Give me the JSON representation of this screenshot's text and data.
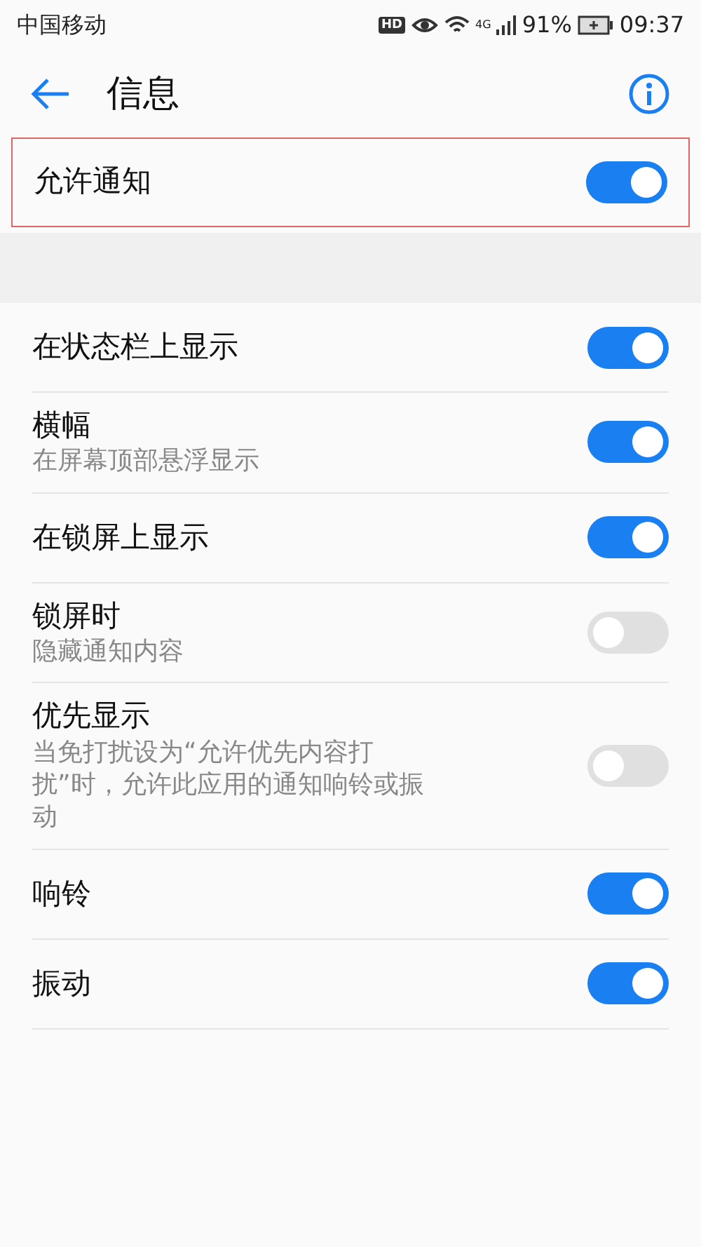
{
  "status_bar": {
    "carrier": "中国移动",
    "hd_badge": "HD",
    "network": "4G",
    "battery": "91%",
    "time": "09:37"
  },
  "header": {
    "title": "信息"
  },
  "main_toggle": {
    "label": "允许通知",
    "on": true,
    "highlighted": true
  },
  "settings": [
    {
      "label": "在状态栏上显示",
      "on": true
    },
    {
      "label": "横幅",
      "description": "在屏幕顶部悬浮显示",
      "on": true
    },
    {
      "label": "在锁屏上显示",
      "on": true
    },
    {
      "label": "锁屏时",
      "description": "隐藏通知内容",
      "on": false
    },
    {
      "label": "优先显示",
      "description": "当免打扰设为“允许优先内容打扰”时，允许此应用的通知响铃或振动",
      "on": false
    },
    {
      "label": "响铃",
      "on": true
    },
    {
      "label": "振动",
      "on": true
    }
  ]
}
